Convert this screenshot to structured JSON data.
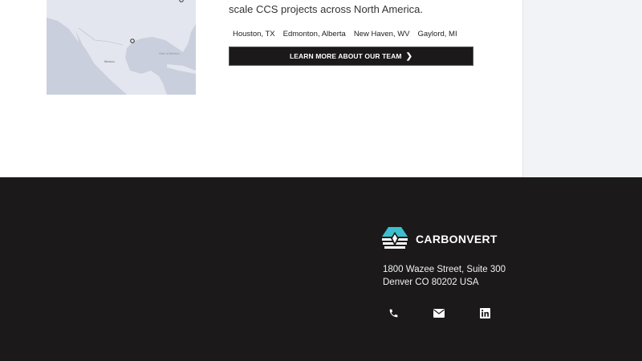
{
  "about": {
    "description_line": "scale CCS projects across North America.",
    "locations": [
      "Houston, TX",
      "Edmonton, Alberta",
      "New Haven, WV",
      "Gaylord, MI"
    ],
    "cta_label": "LEARN MORE ABOUT OUR TEAM",
    "map_labels": {
      "gulf": "Gulf of Mexico",
      "mexico": "Mexico"
    }
  },
  "footer": {
    "brand": "CARBONVERT",
    "address_line1": "1800 Wazee Street, Suite 300",
    "address_line2": "Denver CO 80202 USA",
    "icons": [
      "phone-icon",
      "email-icon",
      "linkedin-icon"
    ],
    "brand_color": "#3bbfcf"
  }
}
